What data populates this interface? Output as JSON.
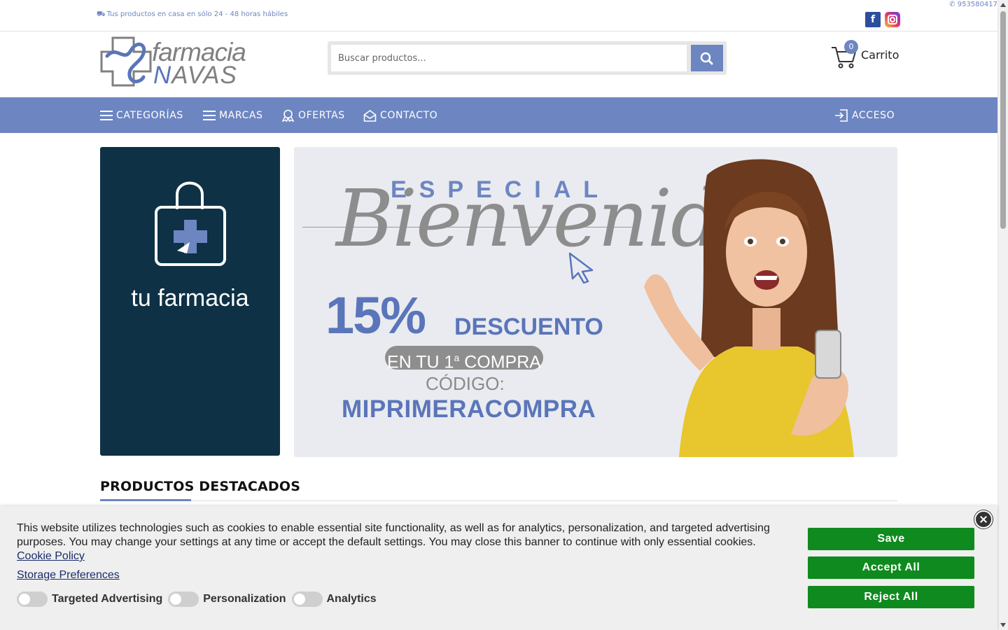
{
  "topbar": {
    "shipping": "Tus productos en casa en sólo 24 - 48 horas hábiles",
    "phone": "953580417",
    "facebook_glyph": "f"
  },
  "logo": {
    "line1": "farmacia",
    "line2_letter": "N",
    "line2_rest": "AVAS"
  },
  "search": {
    "placeholder": "Buscar productos..."
  },
  "cart": {
    "label": "Carrito",
    "count": "0"
  },
  "nav": {
    "categorias": "CATEGORÍAS",
    "marcas": "MARCAS",
    "ofertas": "OFERTAS",
    "contacto": "CONTACTO",
    "acceso": "ACCESO"
  },
  "hero_left": {
    "text": "tu farmacia"
  },
  "hero_right": {
    "especial": "ESPECIAL",
    "bienvenida": "Bienvenida",
    "percent": "15%",
    "descuento": "DESCUENTO",
    "compra_pre": "EN TU 1",
    "compra_sup": "a",
    "compra_post": " COMPRA",
    "codigo_label": "CÓDIGO:",
    "codigo": "MIPRIMERACOMPRA"
  },
  "section": {
    "title": "PRODUCTOS DESTACADOS"
  },
  "cookie": {
    "message": "This website utilizes technologies such as cookies to enable essential site functionality, as well as for analytics, personalization, and targeted advertising purposes. You may change your settings at any time or accept the default settings. You may close this banner to continue with only essential cookies.",
    "policy_link": "Cookie Policy",
    "storage_link": "Storage Preferences",
    "toggles": {
      "targeted": "Targeted Advertising",
      "personalization": "Personalization",
      "analytics": "Analytics"
    },
    "save": "Save",
    "accept": "Accept All",
    "reject": "Reject All"
  },
  "colors": {
    "brand": "#6d86c1",
    "dark_banner": "#0e3145",
    "cookie_button": "#0f8a1e"
  }
}
